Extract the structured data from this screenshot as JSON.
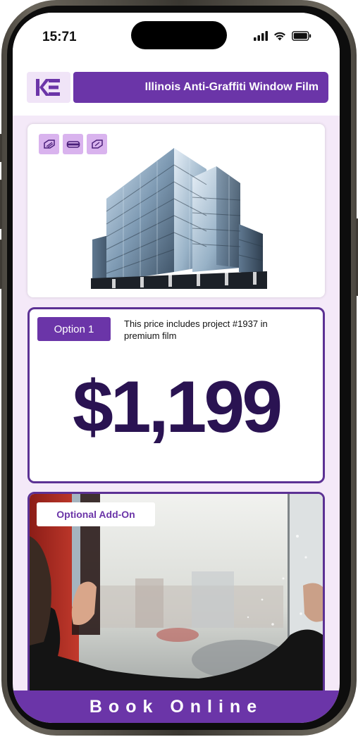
{
  "status_bar": {
    "time": "15:71"
  },
  "header": {
    "logo_text": "KE",
    "title": "Illinois Anti-Graffiti Window Film"
  },
  "product_card": {
    "film_icons": [
      "film-sheet-icon",
      "film-roll-icon",
      "film-sheet-icon"
    ]
  },
  "option": {
    "label": "Option 1",
    "description": "This price includes project #1937 in premium film",
    "price": "$1,199"
  },
  "addon": {
    "label": "Optional Add-On"
  },
  "footer": {
    "cta_label": "Book Online"
  },
  "colors": {
    "brand_purple": "#6b35a8",
    "dark_purple": "#2a1352",
    "background_tint": "#f4e9f8"
  }
}
